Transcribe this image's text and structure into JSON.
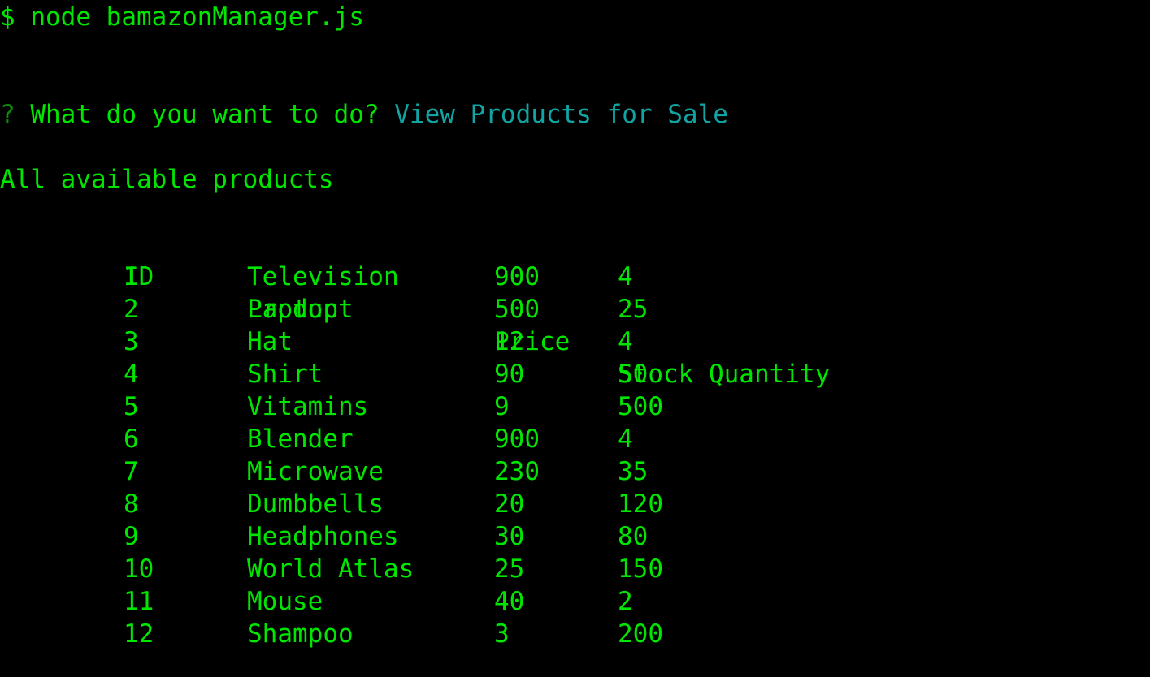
{
  "colors": {
    "background": "#000000",
    "text": "#00e600",
    "question_mark": "#0f8a0f",
    "answer": "#12a3a3"
  },
  "command": {
    "prompt": "$",
    "text": "node bamazonManager.js"
  },
  "question": {
    "mark": "?",
    "text": "What do you want to do?",
    "answer": "View Products for Sale"
  },
  "section_title": "All available products",
  "table": {
    "headers": [
      "ID",
      "Product",
      "Price",
      "Stock Quantity"
    ],
    "rows": [
      [
        "1",
        "Television",
        "900",
        "4"
      ],
      [
        "2",
        "Laptop",
        "500",
        "25"
      ],
      [
        "3",
        "Hat",
        "12",
        "4"
      ],
      [
        "4",
        "Shirt",
        "90",
        "50"
      ],
      [
        "5",
        "Vitamins",
        "9",
        "500"
      ],
      [
        "6",
        "Blender",
        "900",
        "4"
      ],
      [
        "7",
        "Microwave",
        "230",
        "35"
      ],
      [
        "8",
        "Dumbbells",
        "20",
        "120"
      ],
      [
        "9",
        "Headphones",
        "30",
        "80"
      ],
      [
        "10",
        "World Atlas",
        "25",
        "150"
      ],
      [
        "11",
        "Mouse",
        "40",
        "2"
      ],
      [
        "12",
        "Shampoo",
        "3",
        "200"
      ]
    ]
  }
}
